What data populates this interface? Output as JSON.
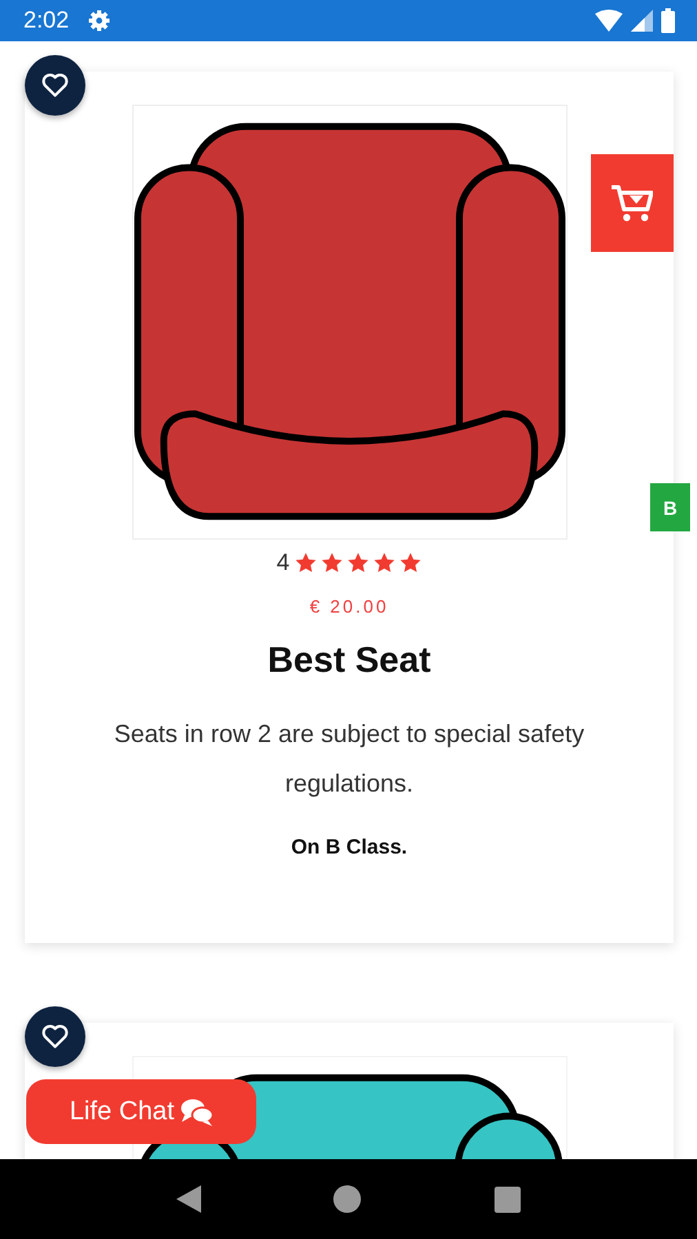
{
  "status_bar": {
    "time": "2:02"
  },
  "products": [
    {
      "color": "#c73434",
      "rating": "4",
      "stars": 5,
      "price": "€ 20.00",
      "title": "Best Seat",
      "description": "Seats in row 2 are subject to special safety regulations.",
      "note": "On B Class.",
      "class_badge": "B"
    },
    {
      "color": "#36c4c4"
    }
  ],
  "chat_button": {
    "label": "Life Chat"
  }
}
